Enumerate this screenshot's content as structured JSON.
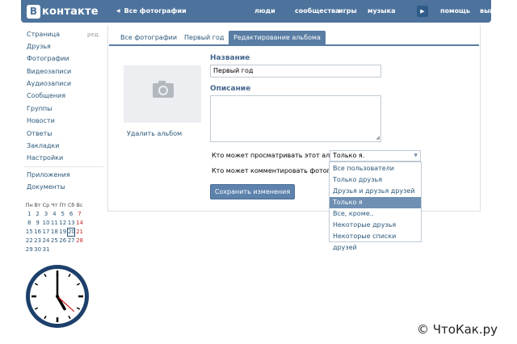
{
  "header": {
    "logo_letter": "В",
    "logo_text": "контакте",
    "back_label": "Все фотографии",
    "nav": [
      "люди",
      "сообщества",
      "игры",
      "музыка",
      "помощь",
      "выйти"
    ],
    "brand_color": "#4d739c"
  },
  "sidebar": {
    "edit_label": "ред.",
    "items": [
      "Страница",
      "Друзья",
      "Фотографии",
      "Видеозаписи",
      "Аудиозаписи",
      "Сообщения",
      "Группы",
      "Новости",
      "Ответы",
      "Закладки",
      "Настройки"
    ],
    "extra": [
      "Приложения",
      "Документы"
    ]
  },
  "calendar": {
    "weekdays": [
      "Пн",
      "Вт",
      "Ср",
      "Чт",
      "Пт",
      "Сб",
      "Вс"
    ],
    "weeks": [
      [
        "1",
        "2",
        "3",
        "4",
        "5",
        "6",
        "7"
      ],
      [
        "8",
        "9",
        "10",
        "11",
        "12",
        "13",
        "14"
      ],
      [
        "15",
        "16",
        "17",
        "18",
        "19",
        "20",
        "21"
      ],
      [
        "22",
        "23",
        "24",
        "25",
        "26",
        "27",
        "28"
      ],
      [
        "29",
        "30",
        "31",
        "",
        "",
        "",
        ""
      ]
    ],
    "today": "20"
  },
  "clock": {
    "hour": 5,
    "minute": 0,
    "second": 22
  },
  "tabs": [
    "Все фотографии",
    "Первый год",
    "Редактирование альбома"
  ],
  "form": {
    "delete_label": "Удалить альбом",
    "name_label": "Название",
    "name_value": "Первый год",
    "desc_label": "Описание",
    "desc_value": "",
    "view_question": "Кто может просматривать этот альбом?",
    "view_selected": "Только я.",
    "comment_question": "Кто может комментировать фотографии?",
    "options": [
      "Все пользователи",
      "Только друзья",
      "Друзья и друзья друзей",
      "Только я",
      "Все, кроме..",
      "Некоторые друзья",
      "Некоторые списки друзей"
    ],
    "selected_option": "Только я",
    "save_label": "Сохранить изменения"
  },
  "watermark": "© ЧтоКак.ру"
}
